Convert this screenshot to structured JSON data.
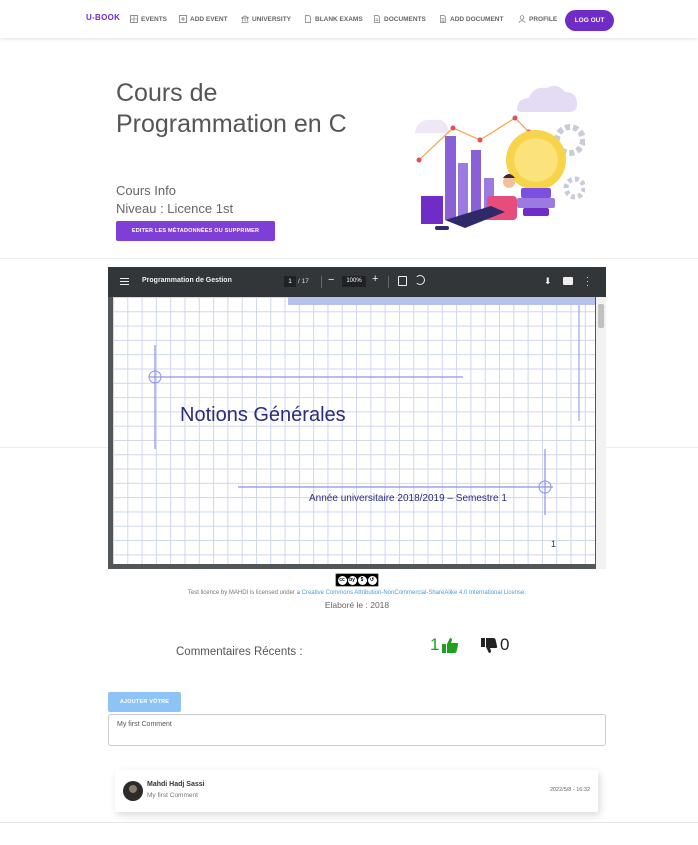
{
  "nav": {
    "brand": "U-BOOK",
    "items": [
      {
        "label": "EVENTS",
        "icon": "grid-icon"
      },
      {
        "label": "ADD EVENT",
        "icon": "add-box-icon"
      },
      {
        "label": "UNIVERSITY",
        "icon": "bank-icon"
      },
      {
        "label": "BLANK EXAMS",
        "icon": "file-icon"
      },
      {
        "label": "DOCUMENTS",
        "icon": "document-icon"
      },
      {
        "label": "ADD DOCUMENT",
        "icon": "document-add-icon"
      },
      {
        "label": "PROFILE",
        "icon": "user-icon"
      }
    ],
    "logout": "LOG OUT"
  },
  "hero": {
    "title": "Cours de Programmation en C",
    "course": "Cours Info",
    "level": "Niveau : Licence 1st",
    "edit_button": "EDITER LES MÉTADONNÉES OU SUPPRIMER"
  },
  "viewer": {
    "doc_title": "Programmation de Gestion",
    "page": "1",
    "page_total": "/ 17",
    "zoom": "100%",
    "slide_title": "Notions Générales",
    "slide_subtitle": "Année universitaire 2018/2019 – Semestre 1",
    "slide_number": "1"
  },
  "license": {
    "prefix": "Test licence by MAHDI is licensed under a ",
    "link": "Creative Commons Attribution-NonCommercial-ShareAlike 4.0 International License",
    "suffix": ".",
    "elabore": "Elaboré le : 2018"
  },
  "comments": {
    "title": "Commentaires Récents :",
    "likes": "1",
    "dislikes": "0",
    "add_button": "AJOUTER VÔTRE",
    "input_value": "My first Comment",
    "items": [
      {
        "author": "Mahdi Hadj Sassi",
        "text": "My first Comment",
        "date": "2022/5/8 - 16:32"
      }
    ]
  },
  "colors": {
    "accent": "#6f2cc7",
    "like": "#1f9e1f",
    "add_button": "#8ec3f5"
  }
}
